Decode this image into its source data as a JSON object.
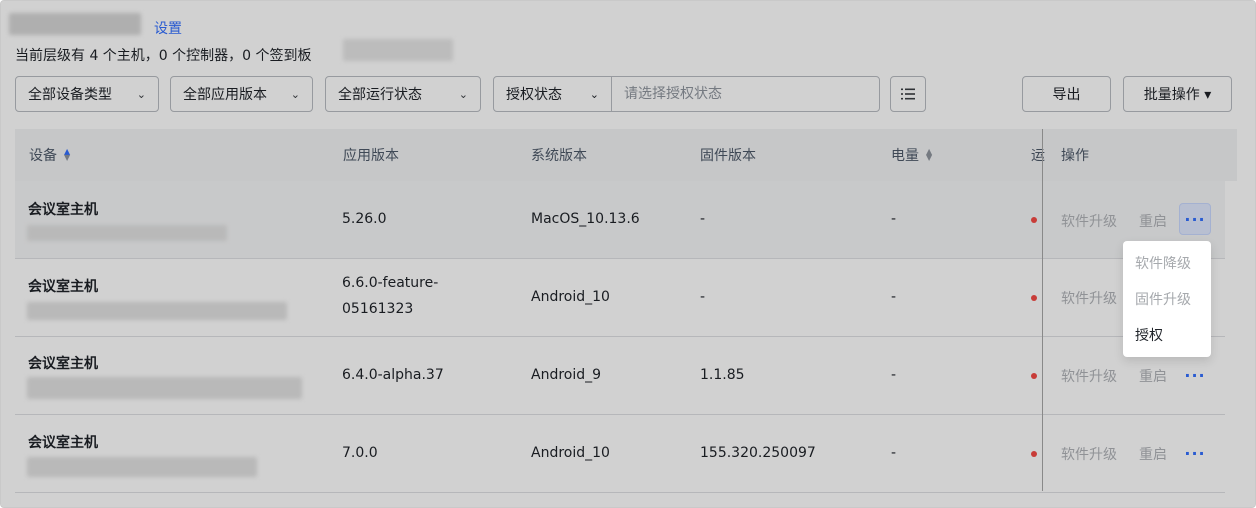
{
  "header": {
    "settings_link": "设置",
    "summary": "当前层级有 4 个主机，0 个控制器，0 个签到板"
  },
  "filters": {
    "device_type": "全部设备类型",
    "app_version": "全部应用版本",
    "run_status": "全部运行状态",
    "auth_label": "授权状态",
    "auth_placeholder": "请选择授权状态"
  },
  "toolbar": {
    "export_label": "导出",
    "batch_label": "批量操作 ▾"
  },
  "table": {
    "columns": {
      "device": "设备",
      "app_version": "应用版本",
      "system_version": "系统版本",
      "firmware_version": "固件版本",
      "battery": "电量",
      "run_status_truncated": "运",
      "actions": "操作"
    },
    "rows": [
      {
        "name": "会议室主机",
        "app_version": "5.26.0",
        "system_version": "MacOS_10.13.6",
        "firmware_version": "-",
        "battery": "-"
      },
      {
        "name": "会议室主机",
        "app_version_line1": "6.6.0-feature-",
        "app_version_line2": "05161323",
        "system_version": "Android_10",
        "firmware_version": "-",
        "battery": "-"
      },
      {
        "name": "会议室主机",
        "app_version": "6.4.0-alpha.37",
        "system_version": "Android_9",
        "firmware_version": "1.1.85",
        "battery": "-"
      },
      {
        "name": "会议室主机",
        "app_version": "7.0.0",
        "system_version": "Android_10",
        "firmware_version": "155.320.250097",
        "battery": "-"
      }
    ],
    "actions": {
      "upgrade": "软件升级",
      "restart": "重启",
      "more": "···"
    }
  },
  "dropdown": {
    "items": [
      {
        "label": "软件降级",
        "disabled": true
      },
      {
        "label": "固件升级",
        "disabled": true
      },
      {
        "label": "授权",
        "disabled": false
      }
    ]
  },
  "colors": {
    "accent": "#3370ff",
    "status_dot": "#f54a45"
  }
}
